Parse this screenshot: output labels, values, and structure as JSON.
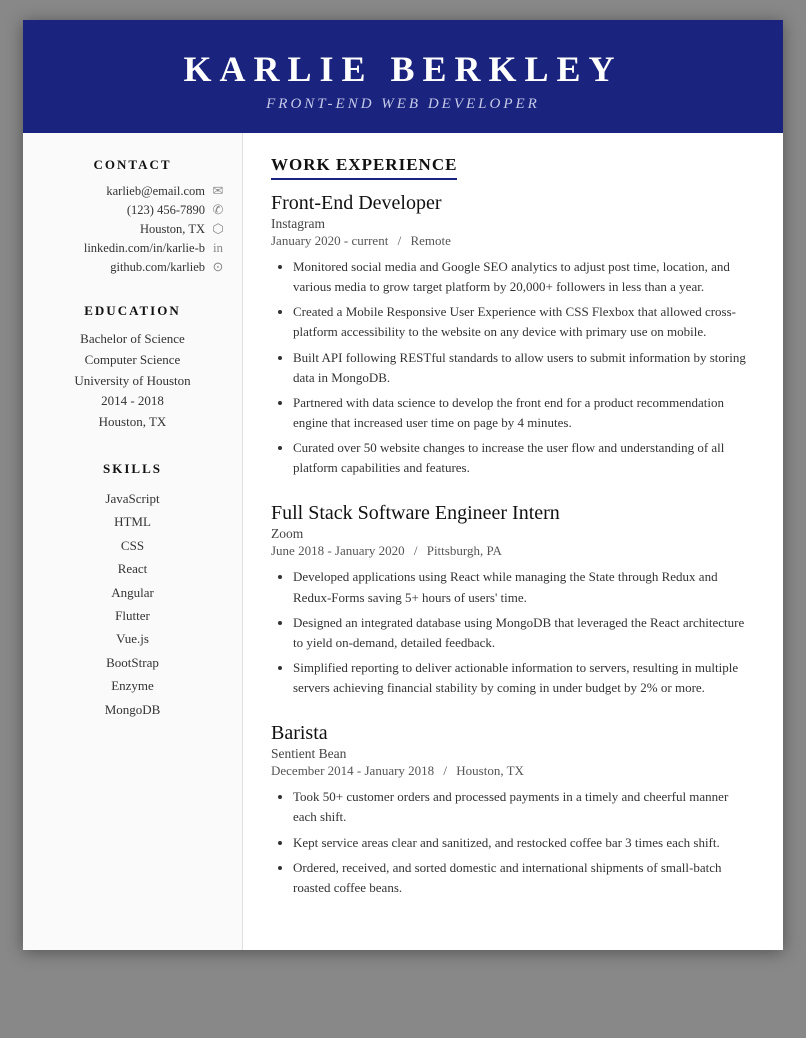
{
  "header": {
    "name": "KARLIE BERKLEY",
    "title": "FRONT-END WEB DEVELOPER"
  },
  "sidebar": {
    "contact_title": "CONTACT",
    "contact": [
      {
        "text": "karlieb@email.com",
        "icon": "✉"
      },
      {
        "text": "(123) 456-7890",
        "icon": "📞"
      },
      {
        "text": "Houston, TX",
        "icon": "📍"
      },
      {
        "text": "linkedin.com/in/karlie-b",
        "icon": "🔗"
      },
      {
        "text": "github.com/karlieb",
        "icon": "⚙"
      }
    ],
    "education_title": "EDUCATION",
    "education": [
      "Bachelor of Science",
      "Computer Science",
      "University of Houston",
      "2014 - 2018",
      "Houston, TX"
    ],
    "skills_title": "SKILLS",
    "skills": [
      "JavaScript",
      "HTML",
      "CSS",
      "React",
      "Angular",
      "Flutter",
      "Vue.js",
      "BootStrap",
      "Enzyme",
      "MongoDB"
    ]
  },
  "main": {
    "work_experience_title": "WORK EXPERIENCE",
    "jobs": [
      {
        "title": "Front-End Developer",
        "company": "Instagram",
        "date": "January 2020 - current",
        "location": "Remote",
        "bullets": [
          "Monitored social media and Google SEO analytics to adjust post time, location, and various media to grow target platform by 20,000+ followers in less than a year.",
          "Created a Mobile Responsive User Experience with CSS Flexbox that allowed cross-platform accessibility to the website on any device with primary use on mobile.",
          "Built API following RESTful standards to allow users to submit information by storing data in MongoDB.",
          "Partnered with data science to develop the front end for a product recommendation engine that increased user time on page by 4 minutes.",
          "Curated over 50 website changes to increase the user flow and understanding of all platform capabilities and features."
        ]
      },
      {
        "title": "Full Stack Software Engineer Intern",
        "company": "Zoom",
        "date": "June 2018 - January 2020",
        "location": "Pittsburgh, PA",
        "bullets": [
          "Developed applications using React while managing the State through Redux and Redux-Forms saving 5+ hours of users' time.",
          "Designed an integrated database using MongoDB that leveraged the React architecture to yield on-demand, detailed feedback.",
          "Simplified reporting to deliver actionable information to servers, resulting in multiple servers achieving financial stability by coming in under budget by 2% or more."
        ]
      },
      {
        "title": "Barista",
        "company": "Sentient Bean",
        "date": "December 2014 - January 2018",
        "location": "Houston, TX",
        "bullets": [
          "Took 50+ customer orders and processed payments in a timely and cheerful manner each shift.",
          "Kept service areas clear and sanitized, and restocked coffee bar 3 times each shift.",
          "Ordered, received, and sorted domestic and international shipments of small-batch roasted coffee beans."
        ]
      }
    ]
  }
}
